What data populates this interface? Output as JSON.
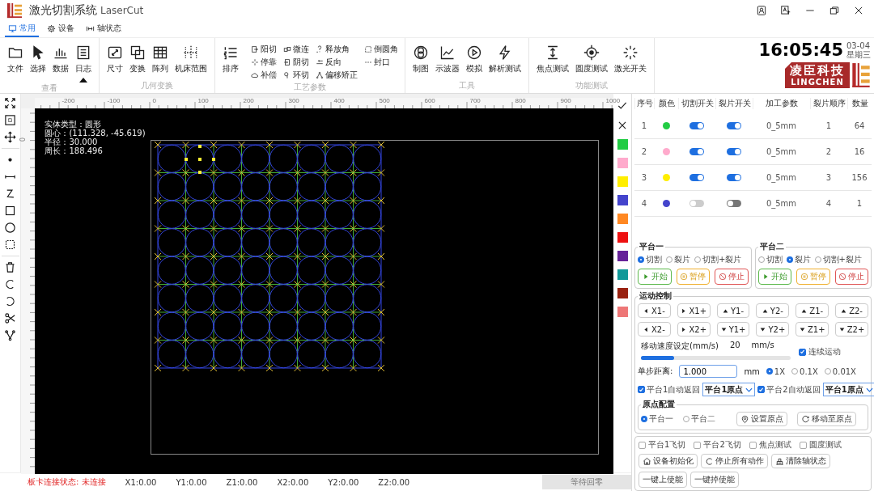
{
  "window": {
    "title": "激光切割系统",
    "subtitle": "LaserCut"
  },
  "tabs": [
    {
      "label": "常用",
      "selected": true
    },
    {
      "label": "设备",
      "selected": false
    },
    {
      "label": "轴状态",
      "selected": false
    }
  ],
  "ribbon": [
    {
      "label": "查看",
      "items": [
        "文件",
        "选择",
        "数据",
        "日志"
      ]
    },
    {
      "label": "几何变换",
      "items": [
        "尺寸",
        "变换",
        "阵列",
        "机床范围"
      ]
    },
    {
      "label": "工艺参数",
      "items": [
        "排序"
      ],
      "small_items": [
        "阳切",
        "微连",
        "释放角",
        "倒圆角",
        "停靠",
        "阴切",
        "反向",
        "封口",
        "补偿",
        "环切",
        "偏移矫正"
      ]
    },
    {
      "label": "工具",
      "items": [
        "制图",
        "示波器",
        "模拟",
        "解析测试"
      ]
    },
    {
      "label": "功能测试",
      "items": [
        "焦点测试",
        "圆度测试",
        "激光开关"
      ]
    }
  ],
  "clock": {
    "time": "16:05:45",
    "date": "03-04",
    "weekday": "星期三"
  },
  "brand": {
    "name": "凌臣科技",
    "latin": "LINGCHEN"
  },
  "canvas": {
    "x_ruler": [
      "-200",
      "-100",
      "0",
      "100",
      "200",
      "300",
      "400",
      "500",
      "600",
      "700",
      "800",
      "900",
      "1000"
    ],
    "y_ruler": [
      "0"
    ],
    "info": [
      "实体类型：圆形",
      "圆心：(111.328, -45.619)",
      "半径：30.000",
      "周长：188.496"
    ]
  },
  "palette": [
    {
      "color": "#22cc44"
    },
    {
      "color": "#ffaacc"
    },
    {
      "color": "#ffee00"
    },
    {
      "color": "#4444cc"
    },
    {
      "color": "#ff8822"
    },
    {
      "color": "#ee1111"
    },
    {
      "color": "#662299"
    },
    {
      "color": "#119999"
    },
    {
      "color": "#992211"
    },
    {
      "color": "#ee7777"
    }
  ],
  "layers": {
    "columns": [
      "序号",
      "颜色",
      "切割开关",
      "裂片开关",
      "加工参数",
      "裂片顺序",
      "数量"
    ],
    "rows": [
      {
        "index": "1",
        "color": "#22cc44",
        "cut_on": true,
        "split_on": true,
        "param": "0_5mm",
        "order": "1",
        "count": "64"
      },
      {
        "index": "2",
        "color": "#ffaacc",
        "cut_on": true,
        "split_on": true,
        "param": "0_5mm",
        "order": "2",
        "count": "16"
      },
      {
        "index": "3",
        "color": "#ffee00",
        "cut_on": true,
        "split_on": true,
        "param": "0_5mm",
        "order": "3",
        "count": "156"
      },
      {
        "index": "4",
        "color": "#4444cc",
        "cut_on": false,
        "split_on": false,
        "param": "0_5mm",
        "order": "4",
        "count": "1"
      }
    ]
  },
  "platforms": [
    {
      "title": "平台一",
      "modes": [
        {
          "label": "切割",
          "selected": true
        },
        {
          "label": "裂片",
          "selected": false
        },
        {
          "label": "切割+裂片",
          "selected": false
        }
      ],
      "buttons": [
        {
          "kind": "start",
          "label": "开始"
        },
        {
          "kind": "pause",
          "label": "暂停"
        },
        {
          "kind": "stop",
          "label": "停止"
        }
      ]
    },
    {
      "title": "平台二",
      "modes": [
        {
          "label": "切割",
          "selected": false
        },
        {
          "label": "裂片",
          "selected": true
        },
        {
          "label": "切割+裂片",
          "selected": false
        }
      ],
      "buttons": [
        {
          "kind": "start",
          "label": "开始"
        },
        {
          "kind": "pause",
          "label": "暂停"
        },
        {
          "kind": "stop",
          "label": "停止"
        }
      ]
    }
  ],
  "motion": {
    "title": "运动控制",
    "jog": [
      {
        "kind": "left",
        "label": "X1-"
      },
      {
        "kind": "right",
        "label": "X1+"
      },
      {
        "kind": "up",
        "label": "Y1-"
      },
      {
        "kind": "up",
        "label": "Y2-"
      },
      {
        "kind": "up",
        "label": "Z1-"
      },
      {
        "kind": "up",
        "label": "Z2-"
      },
      {
        "kind": "left",
        "label": "X2-"
      },
      {
        "kind": "right",
        "label": "X2+"
      },
      {
        "kind": "down",
        "label": "Y1+"
      },
      {
        "kind": "down",
        "label": "Y2+"
      },
      {
        "kind": "down",
        "label": "Z1+"
      },
      {
        "kind": "down",
        "label": "Z2+"
      }
    ],
    "speed_label": "移动速度设定(mm/s)",
    "speed_value": "20",
    "speed_unit": "mm/s",
    "speed": {
      "level": 0.22
    },
    "continuous": {
      "label": "连续运动",
      "checked": true
    },
    "step_label": "单步距离:",
    "step_value": "1.000",
    "step_unit": "mm",
    "step_modes": [
      {
        "label": "1X",
        "selected": true
      },
      {
        "label": "0.1X",
        "selected": false
      },
      {
        "label": "0.01X",
        "selected": false
      }
    ],
    "auto_return": [
      {
        "label": "平台1自动返回",
        "checked": true,
        "value": "平台1原点"
      },
      {
        "label": "平台2自动返回",
        "checked": true,
        "value": "平台1原点"
      }
    ],
    "origin": {
      "title": "原点配置",
      "platforms": [
        {
          "label": "平台一",
          "selected": true
        },
        {
          "label": "平台二",
          "selected": false
        }
      ],
      "buttons": [
        {
          "kind": "set",
          "label": "设置原点"
        },
        {
          "kind": "move",
          "label": "移动至原点"
        }
      ]
    }
  },
  "options": [
    {
      "label": "平台1飞切",
      "checked": false
    },
    {
      "label": "平台2飞切",
      "checked": false
    },
    {
      "label": "焦点测试",
      "checked": false
    },
    {
      "label": "圆度测试",
      "checked": false
    }
  ],
  "actions": [
    {
      "kind": "home",
      "label": "设备初始化"
    },
    {
      "kind": "stop",
      "label": "停止所有动作"
    },
    {
      "kind": "clear",
      "label": "清除轴状态"
    }
  ],
  "enable_buttons": [
    "一键上使能",
    "一键掉使能"
  ],
  "status_bar": {
    "connection": "板卡连接状态: 未连接",
    "coords": [
      "X1:0.00",
      "Y1:0.00",
      "Z1:0.00",
      "X2:0.00",
      "Y2:0.00",
      "Z2:0.00"
    ],
    "home_button": {
      "label": "等待回零",
      "disabled": true
    }
  }
}
